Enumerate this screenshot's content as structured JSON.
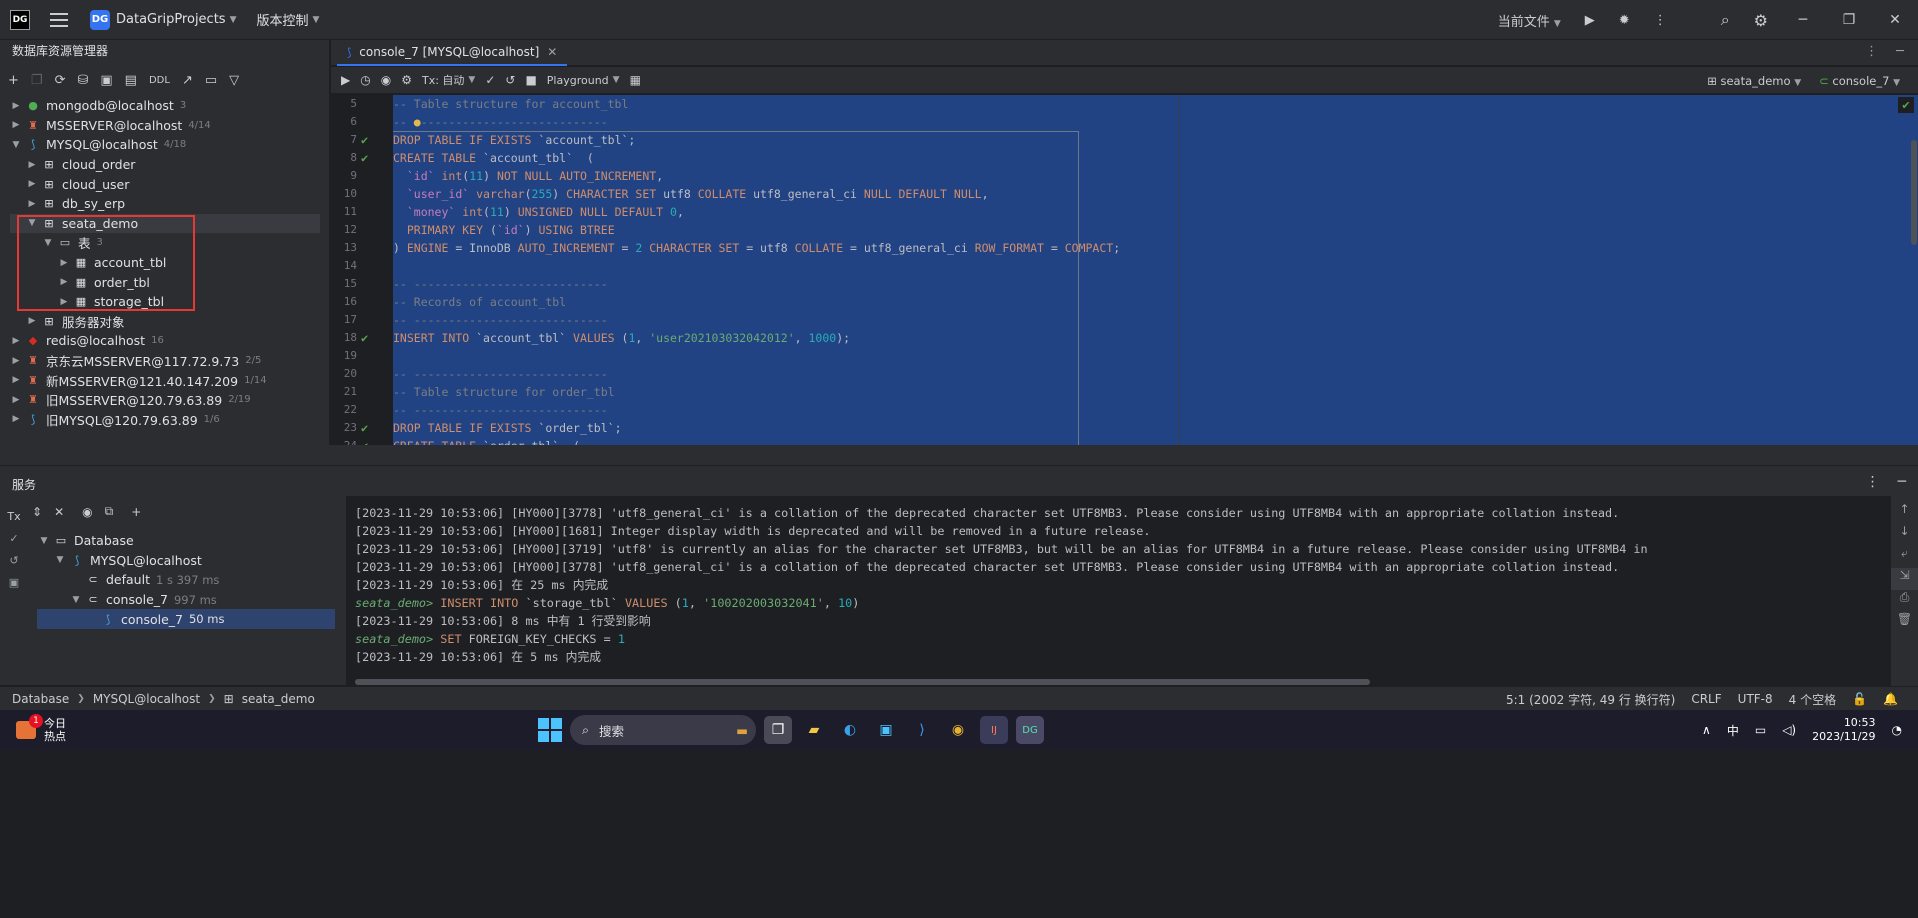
{
  "titlebar": {
    "logo": "DG",
    "project_badge": "DG",
    "project_name": "DataGripProjects",
    "vcs": "版本控制",
    "current_file": "当前文件"
  },
  "leftpanel": {
    "title": "数据库资源管理器",
    "ddl_label": "DDL",
    "tree": [
      {
        "label": "mongodb@localhost",
        "count": "3"
      },
      {
        "label": "MSSERVER@localhost",
        "count": "4/14"
      },
      {
        "label": "MYSQL@localhost",
        "count": "4/18"
      },
      {
        "label": "cloud_order"
      },
      {
        "label": "cloud_user"
      },
      {
        "label": "db_sy_erp"
      },
      {
        "label": "seata_demo"
      },
      {
        "label": "表",
        "count": "3"
      },
      {
        "label": "account_tbl"
      },
      {
        "label": "order_tbl"
      },
      {
        "label": "storage_tbl"
      },
      {
        "label": "服务器对象"
      },
      {
        "label": "redis@localhost",
        "count": "16"
      },
      {
        "label": "京东云MSSERVER@117.72.9.73",
        "count": "2/5"
      },
      {
        "label": "新MSSERVER@121.40.147.209",
        "count": "1/14"
      },
      {
        "label": "旧MSSERVER@120.79.63.89",
        "count": "2/19"
      },
      {
        "label": "旧MYSQL@120.79.63.89",
        "count": "1/6"
      }
    ]
  },
  "editor": {
    "tab_label": "console_7 [MYSQL@localhost]",
    "tx_label": "Tx: 自动",
    "playground": "Playground",
    "schema": "seata_demo",
    "session": "console_7",
    "line_numbers": [
      "5",
      "6",
      "7",
      "8",
      "9",
      "10",
      "11",
      "12",
      "13",
      "14",
      "15",
      "16",
      "17",
      "18",
      "19",
      "20",
      "21",
      "22",
      "23",
      "24"
    ],
    "checked_lines": [
      "7",
      "8",
      "13",
      "18",
      "23",
      "24"
    ]
  },
  "services": {
    "title": "服务",
    "tree": [
      {
        "label": "Database"
      },
      {
        "label": "MYSQL@localhost"
      },
      {
        "label": "default",
        "time": "1 s 397 ms"
      },
      {
        "label": "console_7",
        "time": "997 ms"
      },
      {
        "label": "console_7",
        "time": "50 ms"
      }
    ],
    "console_lines": [
      "[2023-11-29 10:53:06] [HY000][3778] 'utf8_general_ci' is a collation of the deprecated character set UTF8MB3. Please consider using UTF8MB4 with an appropriate collation instead.",
      "[2023-11-29 10:53:06] [HY000][1681] Integer display width is deprecated and will be removed in a future release.",
      "[2023-11-29 10:53:06] [HY000][3719] 'utf8' is currently an alias for the character set UTF8MB3, but will be an alias for UTF8MB4 in a future release. Please consider using UTF8MB4 in",
      "[2023-11-29 10:53:06] [HY000][3778] 'utf8_general_ci' is a collation of the deprecated character set UTF8MB3. Please consider using UTF8MB4 with an appropriate collation instead.",
      "[2023-11-29 10:53:06] 在 25 ms 内完成"
    ],
    "prompt1": "seata_demo>",
    "cmd1_kw1": "INSERT INTO",
    "cmd1_rest": " `storage_tbl` ",
    "cmd1_kw2": "VALUES",
    "cmd1_args_a": " (",
    "cmd1_n1": "1",
    "cmd1_args_b": ", ",
    "cmd1_str": "'100202003032041'",
    "cmd1_args_c": ", ",
    "cmd1_n2": "10",
    "cmd1_args_d": ")",
    "result1": "[2023-11-29 10:53:06] 8 ms 中有 1 行受到影响",
    "prompt2": "seata_demo>",
    "cmd2_kw": "SET",
    "cmd2_rest": " FOREIGN_KEY_CHECKS = ",
    "cmd2_n": "1",
    "result2": "[2023-11-29 10:53:06] 在 5 ms 内完成"
  },
  "statusbar": {
    "crumb1": "Database",
    "crumb2": "MYSQL@localhost",
    "crumb3": "seata_demo",
    "position": "5:1 (2002 字符, 49 行 换行符)",
    "line_sep": "CRLF",
    "encoding": "UTF-8",
    "indent": "4 个空格"
  },
  "taskbar": {
    "weather_title": "今日",
    "weather_sub": "热点",
    "badge": "1",
    "search": "搜索",
    "ime": "中",
    "time": "10:53",
    "date": "2023/11/29"
  },
  "colors": {
    "accent": "#3574f0",
    "selection": "#214283",
    "highlight_box": "#e53935",
    "success": "#57a64a"
  }
}
